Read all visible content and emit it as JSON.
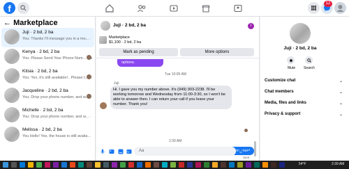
{
  "topbar": {
    "logo": "f",
    "icons": [
      "search-icon",
      "home-icon",
      "people-icon",
      "video-icon",
      "marketplace-icon",
      "groups-icon",
      "grid-icon",
      "messenger-icon",
      "bell-icon",
      "account-icon"
    ],
    "notification_count": "12"
  },
  "left_panel": {
    "back": "←",
    "title": "Marketplace",
    "conversations": [
      {
        "title": "Juji · 2 bd, 2 ba",
        "preview": "You: Thanks I'll message you in a mo...",
        "time": "1m"
      },
      {
        "title": "Kenya · 2 bd, 2 ba",
        "preview": "You: Please Send Your Phone Num...",
        "time": "1m"
      },
      {
        "title": "Kitsia · 2 bd, 2 ba",
        "preview": "You: Yes, it's still available!.. Please t...",
        "time": "1m"
      },
      {
        "title": "Jacqueline · 2 bd, 2 ba",
        "preview": "You: Drop your phone number, and w...",
        "time": "3m"
      },
      {
        "title": "Michelle · 2 bd, 2 ba",
        "preview": "You: Drop your phone number, and w...",
        "time": "3m"
      },
      {
        "title": "Melissa · 2 bd, 2 ba",
        "preview": "You Hello! Yes, the house is still availa...",
        "time": "3m"
      }
    ]
  },
  "chat": {
    "title": "Juji · 2 bd, 2 ba",
    "listing_label": "Marketplace",
    "listing_detail": "$1,100 · 2 bd, 2 ba",
    "mark_pending": "Mark as pending",
    "more_options": "More options",
    "prev_bubble_tail": "options.",
    "timestamp1": "Tue 10:05 AM",
    "sender": "Juji",
    "received_message": "Hi. I gave you my number above. It's (949) 903-2238. I'll be working tomorrow and Wednesday from 11:00-3:30, so I won't be able to answer then. I can return your call if you leave your number. Thank you!",
    "timestamp2": "2:39 AM",
    "sent_message": "Thanks I'll message you in a moment",
    "sent_status": "Sent",
    "composer_placeholder": "Aa"
  },
  "right_panel": {
    "name": "Juji · 2 bd, 2 ba",
    "mute_label": "Mute",
    "search_label": "Search",
    "sections": [
      "Customize chat",
      "Chat members",
      "Media, files and links",
      "Privacy & support"
    ]
  },
  "taskbar": {
    "temp": "54°F",
    "time": "2:39 AM"
  },
  "colors": {
    "brand": "#1877f2",
    "purple_bubble": "#8a48f0",
    "badge": "#e41e3f"
  }
}
